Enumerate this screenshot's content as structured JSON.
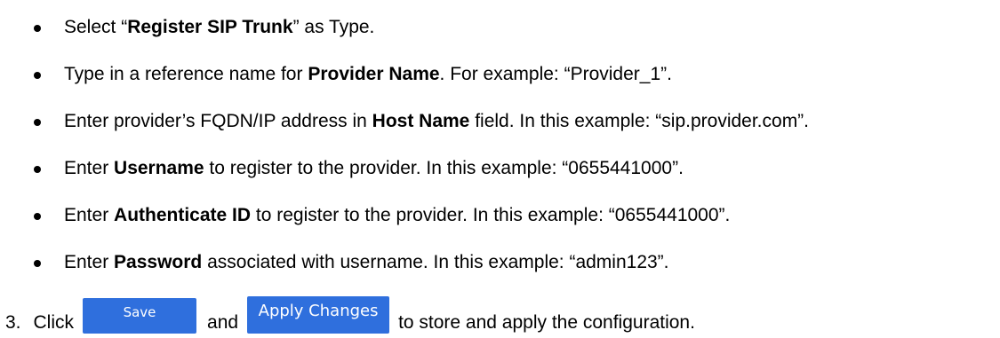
{
  "bullets": [
    {
      "pre": "Select “",
      "bold": "Register SIP Trunk",
      "post": "” as Type."
    },
    {
      "pre": "Type in a reference name for ",
      "bold": "Provider Name",
      "post": ". For example: “Provider_1”."
    },
    {
      "pre": "Enter provider’s FQDN/IP address in ",
      "bold": "Host Name",
      "post": " field. In this example: “sip.provider.com”."
    },
    {
      "pre": "Enter ",
      "bold": "Username",
      "post": " to register to the provider. In this example: “0655441000”."
    },
    {
      "pre": "Enter ",
      "bold": "Authenticate ID",
      "post": " to register to the provider. In this example: “0655441000”."
    },
    {
      "pre": "Enter ",
      "bold": "Password",
      "post": " associated with username. In this example: “admin123”."
    }
  ],
  "step": {
    "number": "3.",
    "click": "Click",
    "and": "and",
    "tail": "to store and apply the configuration.",
    "save_label": "Save",
    "apply_label": "Apply Changes"
  },
  "colors": {
    "button_bg": "#2f6fdd",
    "button_text": "#ffffff"
  }
}
